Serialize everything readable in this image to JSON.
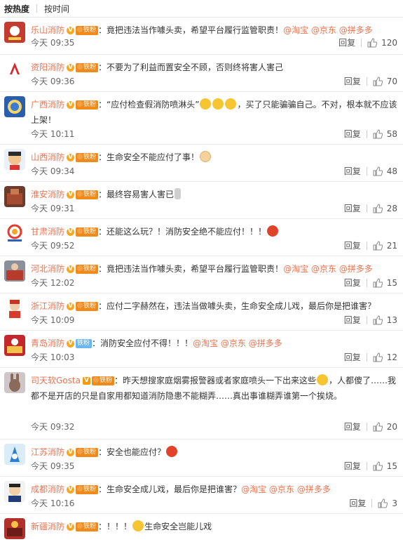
{
  "tabs": [
    {
      "label": "按热度"
    },
    {
      "label": "按时间"
    }
  ],
  "actions": {
    "reply_label": "回复"
  },
  "comments": [
    {
      "name": "乐山消防",
      "fan": "铁粉",
      "colon": "：",
      "text": "竟把违法当作噱头卖，希望平台履行监管职责！",
      "links": [
        "@淘宝",
        "@京东",
        "@拼多多"
      ],
      "time": "今天 09:35",
      "likes": "120"
    },
    {
      "name": "资阳消防",
      "fan": "铁粉",
      "colon": "：",
      "text": "不要为了利益而置安全不顾，否则终将害人害己",
      "time": "今天 09:36",
      "likes": "70"
    },
    {
      "name": "广西消防",
      "fan": "铁粉",
      "colon": "：",
      "text": "“应付检查假消防喷淋头”",
      "text2": "，买了只能骗骗自己。不对，根本就不应该上架！",
      "time": "今天 10:11",
      "likes": "58"
    },
    {
      "name": "山西消防",
      "fan": "铁粉",
      "colon": "：",
      "text": "生命安全不能应付了事！",
      "time": "今天 09:34",
      "likes": "48"
    },
    {
      "name": "淮安消防",
      "fan": "铁粉",
      "colon": "：",
      "text": "最终容易害人害已",
      "time": "今天 09:31",
      "likes": "28"
    },
    {
      "name": "甘肃消防",
      "fan": "铁粉",
      "colon": "：",
      "text": "还能这么玩？！消防安全绝不能应付！！！",
      "time": "今天 09:52",
      "likes": "21"
    },
    {
      "name": "河北消防",
      "fan": "铁粉",
      "colon": "：",
      "text": "竟把违法当作噱头卖，希望平台履行监管职责！",
      "links": [
        "@淘宝",
        "@京东",
        "@拼多多"
      ],
      "time": "今天 12:02",
      "likes": "15"
    },
    {
      "name": "浙江消防",
      "fan": "铁粉",
      "colon": "：",
      "text": "应付二字赫然在，违法当做噱头卖，生命安全成儿戏，最后你是把谁害？",
      "time": "今天 10:09",
      "likes": "13"
    },
    {
      "name": "青岛消防",
      "fan": "铁粉",
      "colon": "：",
      "text": "消防安全应付不得！！！",
      "links": [
        "@淘宝",
        "@京东",
        "@拼多多"
      ],
      "time": "今天 10:03",
      "likes": "12"
    },
    {
      "name": "司天软Gosta",
      "fan": "铁粉",
      "colon": "：",
      "text": "昨天想搜家庭烟雾报警器或者家庭喷头一下出来这些",
      "text2": "，人都傻了……我都不是开店的只是自家用都知道消防隐患不能糊弄……真出事谁糊弄谁第一个挨烧。",
      "time": "今天 09:32",
      "likes": "20"
    },
    {
      "name": "江苏消防",
      "fan": "铁粉",
      "colon": "：",
      "text": "安全也能应付？",
      "time": "今天 09:35",
      "likes": "15"
    },
    {
      "name": "成都消防",
      "fan": "铁粉",
      "colon": "：",
      "text": "生命安全成儿戏，最后你是把谁害？",
      "links": [
        "@淘宝",
        "@京东",
        "@拼多多"
      ],
      "time": "今天 10:16",
      "likes": "3"
    },
    {
      "name": "新疆消防",
      "fan": "铁粉",
      "colon": "：",
      "text": "！！！",
      "text2": "生命安全岂能儿戏",
      "time": "",
      "likes": ""
    }
  ],
  "colors": {
    "name": "#eb7350",
    "accent": "#f08a1b",
    "fan_blue": "#6cb5ef"
  },
  "icons": [
    "v-badge-icon",
    "fan-badge-icon",
    "thumb-up-icon",
    "emoji-icon"
  ]
}
